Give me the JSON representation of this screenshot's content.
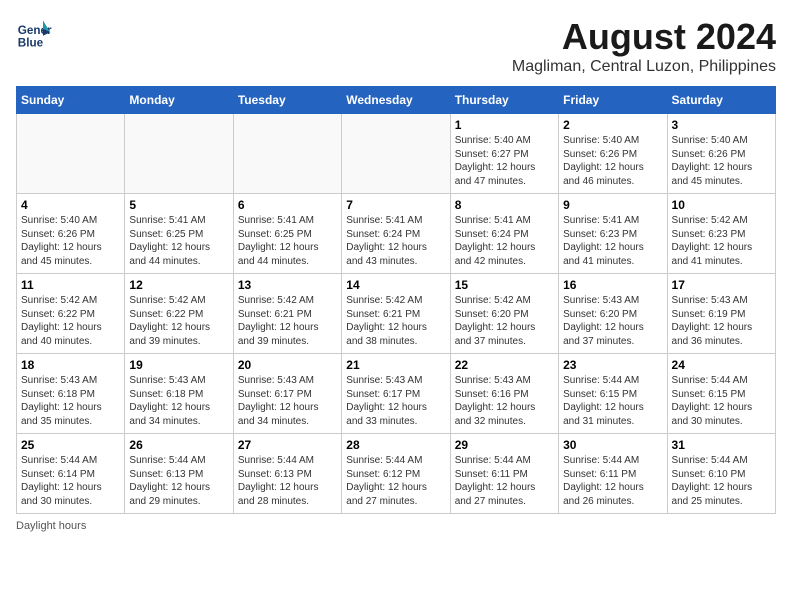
{
  "logo": {
    "line1": "General",
    "line2": "Blue"
  },
  "title": "August 2024",
  "subtitle": "Magliman, Central Luzon, Philippines",
  "days_of_week": [
    "Sunday",
    "Monday",
    "Tuesday",
    "Wednesday",
    "Thursday",
    "Friday",
    "Saturday"
  ],
  "footer": "Daylight hours",
  "weeks": [
    [
      {
        "day": "",
        "info": ""
      },
      {
        "day": "",
        "info": ""
      },
      {
        "day": "",
        "info": ""
      },
      {
        "day": "",
        "info": ""
      },
      {
        "day": "1",
        "info": "Sunrise: 5:40 AM\nSunset: 6:27 PM\nDaylight: 12 hours and 47 minutes."
      },
      {
        "day": "2",
        "info": "Sunrise: 5:40 AM\nSunset: 6:26 PM\nDaylight: 12 hours and 46 minutes."
      },
      {
        "day": "3",
        "info": "Sunrise: 5:40 AM\nSunset: 6:26 PM\nDaylight: 12 hours and 45 minutes."
      }
    ],
    [
      {
        "day": "4",
        "info": "Sunrise: 5:40 AM\nSunset: 6:26 PM\nDaylight: 12 hours and 45 minutes."
      },
      {
        "day": "5",
        "info": "Sunrise: 5:41 AM\nSunset: 6:25 PM\nDaylight: 12 hours and 44 minutes."
      },
      {
        "day": "6",
        "info": "Sunrise: 5:41 AM\nSunset: 6:25 PM\nDaylight: 12 hours and 44 minutes."
      },
      {
        "day": "7",
        "info": "Sunrise: 5:41 AM\nSunset: 6:24 PM\nDaylight: 12 hours and 43 minutes."
      },
      {
        "day": "8",
        "info": "Sunrise: 5:41 AM\nSunset: 6:24 PM\nDaylight: 12 hours and 42 minutes."
      },
      {
        "day": "9",
        "info": "Sunrise: 5:41 AM\nSunset: 6:23 PM\nDaylight: 12 hours and 41 minutes."
      },
      {
        "day": "10",
        "info": "Sunrise: 5:42 AM\nSunset: 6:23 PM\nDaylight: 12 hours and 41 minutes."
      }
    ],
    [
      {
        "day": "11",
        "info": "Sunrise: 5:42 AM\nSunset: 6:22 PM\nDaylight: 12 hours and 40 minutes."
      },
      {
        "day": "12",
        "info": "Sunrise: 5:42 AM\nSunset: 6:22 PM\nDaylight: 12 hours and 39 minutes."
      },
      {
        "day": "13",
        "info": "Sunrise: 5:42 AM\nSunset: 6:21 PM\nDaylight: 12 hours and 39 minutes."
      },
      {
        "day": "14",
        "info": "Sunrise: 5:42 AM\nSunset: 6:21 PM\nDaylight: 12 hours and 38 minutes."
      },
      {
        "day": "15",
        "info": "Sunrise: 5:42 AM\nSunset: 6:20 PM\nDaylight: 12 hours and 37 minutes."
      },
      {
        "day": "16",
        "info": "Sunrise: 5:43 AM\nSunset: 6:20 PM\nDaylight: 12 hours and 37 minutes."
      },
      {
        "day": "17",
        "info": "Sunrise: 5:43 AM\nSunset: 6:19 PM\nDaylight: 12 hours and 36 minutes."
      }
    ],
    [
      {
        "day": "18",
        "info": "Sunrise: 5:43 AM\nSunset: 6:18 PM\nDaylight: 12 hours and 35 minutes."
      },
      {
        "day": "19",
        "info": "Sunrise: 5:43 AM\nSunset: 6:18 PM\nDaylight: 12 hours and 34 minutes."
      },
      {
        "day": "20",
        "info": "Sunrise: 5:43 AM\nSunset: 6:17 PM\nDaylight: 12 hours and 34 minutes."
      },
      {
        "day": "21",
        "info": "Sunrise: 5:43 AM\nSunset: 6:17 PM\nDaylight: 12 hours and 33 minutes."
      },
      {
        "day": "22",
        "info": "Sunrise: 5:43 AM\nSunset: 6:16 PM\nDaylight: 12 hours and 32 minutes."
      },
      {
        "day": "23",
        "info": "Sunrise: 5:44 AM\nSunset: 6:15 PM\nDaylight: 12 hours and 31 minutes."
      },
      {
        "day": "24",
        "info": "Sunrise: 5:44 AM\nSunset: 6:15 PM\nDaylight: 12 hours and 30 minutes."
      }
    ],
    [
      {
        "day": "25",
        "info": "Sunrise: 5:44 AM\nSunset: 6:14 PM\nDaylight: 12 hours and 30 minutes."
      },
      {
        "day": "26",
        "info": "Sunrise: 5:44 AM\nSunset: 6:13 PM\nDaylight: 12 hours and 29 minutes."
      },
      {
        "day": "27",
        "info": "Sunrise: 5:44 AM\nSunset: 6:13 PM\nDaylight: 12 hours and 28 minutes."
      },
      {
        "day": "28",
        "info": "Sunrise: 5:44 AM\nSunset: 6:12 PM\nDaylight: 12 hours and 27 minutes."
      },
      {
        "day": "29",
        "info": "Sunrise: 5:44 AM\nSunset: 6:11 PM\nDaylight: 12 hours and 27 minutes."
      },
      {
        "day": "30",
        "info": "Sunrise: 5:44 AM\nSunset: 6:11 PM\nDaylight: 12 hours and 26 minutes."
      },
      {
        "day": "31",
        "info": "Sunrise: 5:44 AM\nSunset: 6:10 PM\nDaylight: 12 hours and 25 minutes."
      }
    ]
  ]
}
